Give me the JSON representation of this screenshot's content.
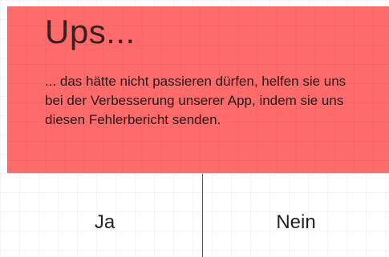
{
  "dialog": {
    "title": "Ups...",
    "message": "... das hätte nicht passieren dürfen, helfen sie uns bei der Verbesserung unserer App, indem sie uns diesen Fehlerbericht senden.",
    "banner_color": "#ff6b6b",
    "buttons": {
      "yes_label": "Ja",
      "no_label": "Nein"
    }
  }
}
